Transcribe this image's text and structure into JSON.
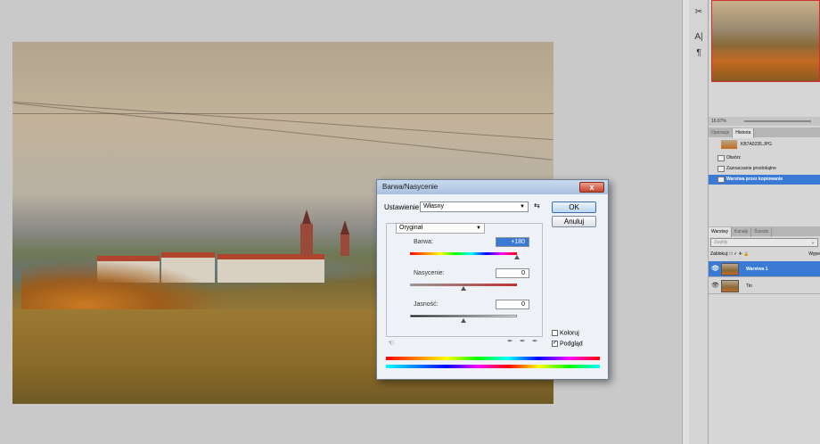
{
  "dialog": {
    "title": "Barwa/Nasycenie",
    "close_label": "x",
    "setting_label": "Ustawienie:",
    "setting_value": "Własny",
    "ok_label": "OK",
    "cancel_label": "Anuluj",
    "channel_value": "Oryginał",
    "hue_label": "Barwa:",
    "hue_value": "+180",
    "saturation_label": "Nasycenie:",
    "saturation_value": "0",
    "lightness_label": "Jasność:",
    "lightness_value": "0",
    "colorize_label": "Koloruj",
    "preview_label": "Podgląd",
    "preview_checked": "✓"
  },
  "tools": [
    "✂",
    "A|",
    "¶"
  ],
  "navigator": {
    "zoom": "16.67%"
  },
  "history": {
    "tabs": [
      "Operacje",
      "Historia"
    ],
    "snapshot": "KB7A0235.JPG",
    "items": [
      "Otwórz",
      "Zaznaczanie prostokątne",
      "Warstwa przez kopiowanie"
    ]
  },
  "layers": {
    "tabs": [
      "Warstwy",
      "Kanały",
      "Ścieżki"
    ],
    "blend_mode": "Zwykły",
    "lock_label": "Zablokuj:",
    "lock_icons": "□ ✓ ✛ 🔒",
    "fill_label": "Wype",
    "rows": [
      {
        "name": "Warstwa 1"
      },
      {
        "name": "Tło"
      }
    ]
  }
}
